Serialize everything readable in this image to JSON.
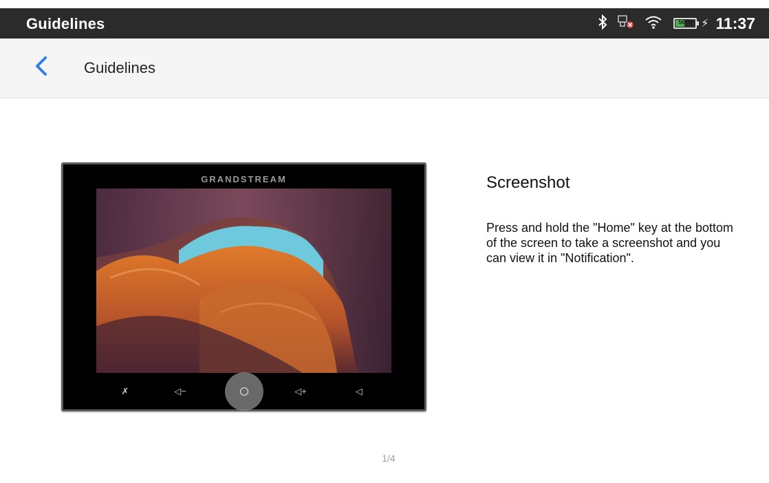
{
  "status_bar": {
    "title": "Guidelines",
    "time": "11:37",
    "battery": {
      "percent": 50,
      "label": "50%"
    },
    "icons": [
      "bluetooth-icon",
      "network-error-icon",
      "wifi-icon",
      "battery-icon",
      "charging-icon"
    ]
  },
  "app_bar": {
    "back_icon": "chevron-left-icon",
    "title": "Guidelines",
    "accent_color": "#2f80ed"
  },
  "guide": {
    "device": {
      "brand": "GRANDSTREAM",
      "keys": [
        "mute-icon",
        "volume-down-icon",
        "home-icon",
        "volume-up-icon",
        "back-icon"
      ]
    },
    "title": "Screenshot",
    "description": "Press and hold the \"Home\" key at the bottom of the screen to take a screenshot and you can view it in \"Notification\".",
    "pager": "1/4"
  }
}
